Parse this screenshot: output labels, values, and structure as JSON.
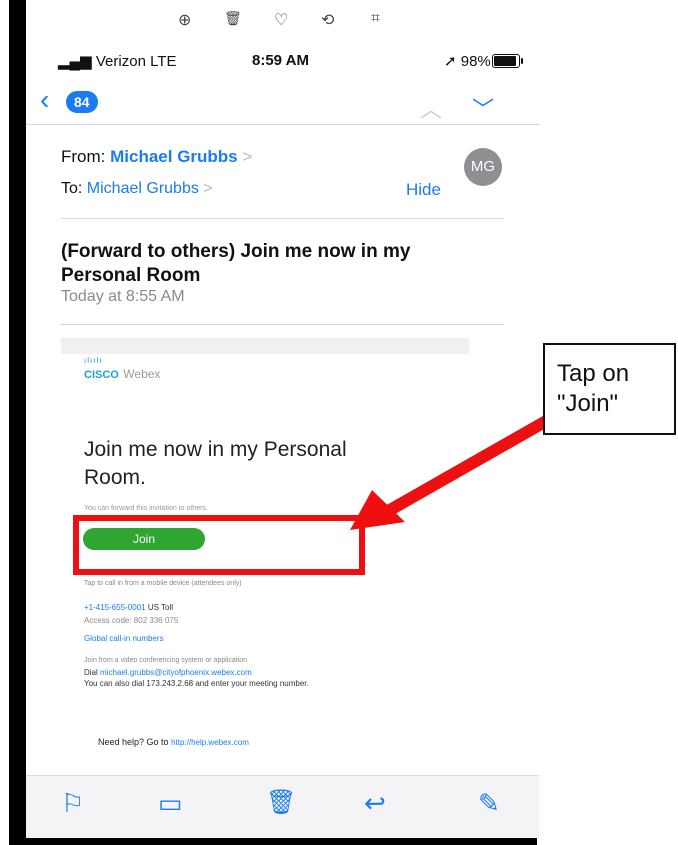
{
  "photo_toolbar": {
    "zoom_icon": "⊕",
    "trash_icon": "🗑",
    "heart_icon": "♡",
    "rotate_icon": "⟲",
    "crop_icon": "⌗"
  },
  "status_bar": {
    "carrier": "Verizon  LTE",
    "time": "8:59 AM",
    "battery": "98%"
  },
  "nav": {
    "back_icon": "‹",
    "unread_count": "84",
    "prev_icon": "︿",
    "next_icon": "﹀"
  },
  "header": {
    "from_label": "From: ",
    "from_name": "Michael Grubbs",
    "to_label": "To: ",
    "to_name": "Michael Grubbs",
    "chevron": ">",
    "avatar_initials": "MG",
    "hide_label": "Hide"
  },
  "message": {
    "subject": "(Forward to others) Join me now in my Personal Room",
    "date": "Today at 8:55 AM"
  },
  "body": {
    "logo_bars": "ılıılı",
    "logo_cisco": "CISCO",
    "logo_webex": "Webex",
    "heading": "Join me now in my Personal Room.",
    "forward_text": "You can forward this invitation to others.",
    "join_button": "Join",
    "call_in_text": "Tap to call in from a mobile device (attendees only)",
    "phone_number": "+1-415-655-0001",
    "phone_suffix": " US Toll",
    "access_code": "Access code: 802 336 075",
    "global_numbers": "Global call-in numbers",
    "video_heading": "Join from a video conferencing system or application",
    "dial_label": "Dial ",
    "dial_address": "michael.grubbs@cityofphoenix.webex.com",
    "dial_alt": "You can also dial 173.243.2.68 and enter your meeting number.",
    "help_text": "Need help? Go to ",
    "help_link": "http://help.webex.com"
  },
  "bottom_toolbar": {
    "flag_icon": "⚐",
    "folder_icon": "▭",
    "trash_icon": "🗑",
    "reply_icon": "↩",
    "compose_icon": "✎"
  },
  "annotation": {
    "callout_line1": "Tap on",
    "callout_line2": "\"Join\"",
    "highlight_color": "#ee1010"
  }
}
